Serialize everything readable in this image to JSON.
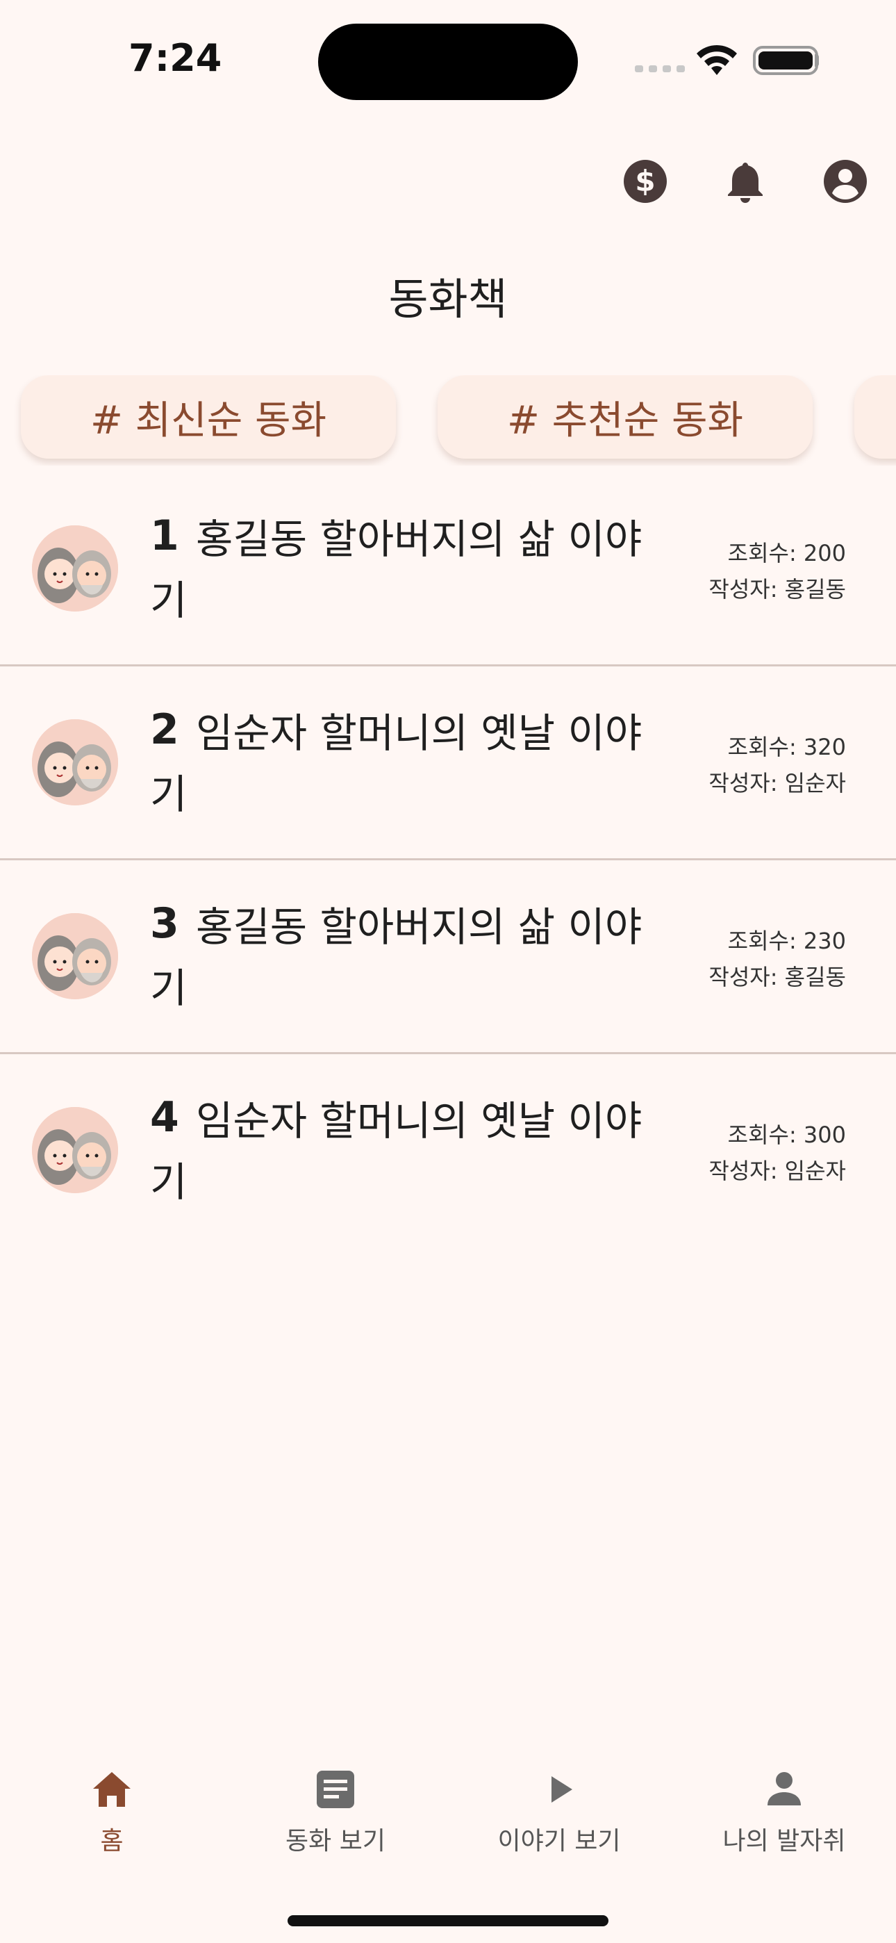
{
  "status": {
    "time": "7:24"
  },
  "header": {
    "title": "동화책",
    "icons": [
      "dollar-icon",
      "bell-icon",
      "account-icon"
    ]
  },
  "chips": [
    {
      "label": "# 최신순 동화"
    },
    {
      "label": "# 추천순 동화"
    },
    {
      "label": ""
    }
  ],
  "stories": [
    {
      "num": "1",
      "title": "홍길동 할아버지의 삶 이야기",
      "views": "조회수: 200",
      "author": "작성자: 홍길동"
    },
    {
      "num": "2",
      "title": "임순자 할머니의 옛날 이야기",
      "views": "조회수: 320",
      "author": "작성자: 임순자"
    },
    {
      "num": "3",
      "title": "홍길동 할아버지의 삶 이야기",
      "views": "조회수: 230",
      "author": "작성자: 홍길동"
    },
    {
      "num": "4",
      "title": "임순자 할머니의 옛날 이야기",
      "views": "조회수: 300",
      "author": "작성자: 임순자"
    }
  ],
  "bottom_nav": [
    {
      "label": "홈",
      "icon": "home-icon",
      "active": true
    },
    {
      "label": "동화 보기",
      "icon": "document-icon",
      "active": false
    },
    {
      "label": "이야기 보기",
      "icon": "play-icon",
      "active": false
    },
    {
      "label": "나의 발자취",
      "icon": "person-icon",
      "active": false
    }
  ],
  "colors": {
    "background": "#fff7f4",
    "accent": "#8a4a2f",
    "chip": "#fdeee7",
    "icon": "#4a3b3a"
  }
}
